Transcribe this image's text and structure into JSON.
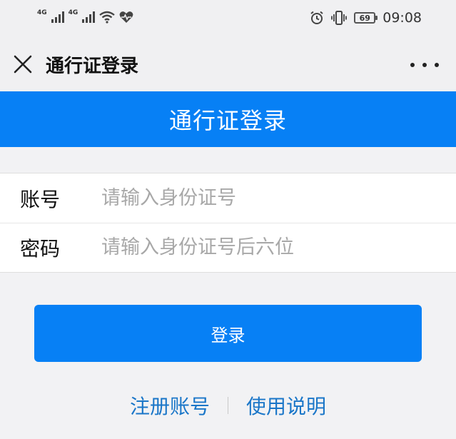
{
  "status_bar": {
    "sim1_network": "4G",
    "sim2_network": "4G",
    "battery_level": "69",
    "time": "09:08",
    "icons": [
      "signal-icon",
      "signal-icon",
      "wifi-icon",
      "heart-icon",
      "alarm-icon",
      "vibrate-icon",
      "battery-icon"
    ]
  },
  "nav": {
    "title": "通行证登录",
    "close_icon": "close-icon",
    "more_icon": "more-icon"
  },
  "banner": {
    "title": "通行证登录"
  },
  "form": {
    "account": {
      "label": "账号",
      "placeholder": "请输入身份证号",
      "value": ""
    },
    "password": {
      "label": "密码",
      "placeholder": "请输入身份证号后六位",
      "value": ""
    }
  },
  "actions": {
    "login_label": "登录",
    "register_label": "注册账号",
    "help_label": "使用说明"
  },
  "colors": {
    "primary": "#0780f5",
    "link": "#1a76c8",
    "background": "#f2f2f4"
  }
}
